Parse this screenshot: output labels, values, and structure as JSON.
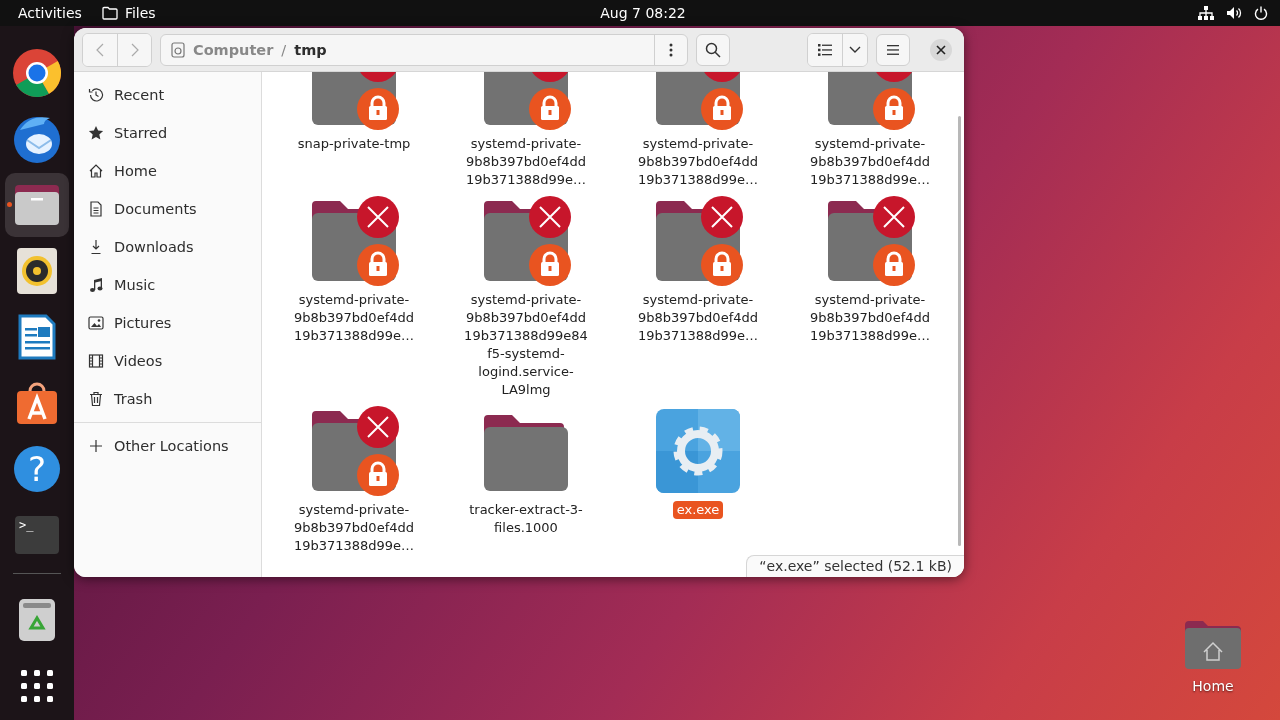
{
  "top_bar": {
    "activities": "Activities",
    "app_name": "Files",
    "clock": "Aug 7  08:22"
  },
  "dock": [
    {
      "kind": "browser",
      "running": false,
      "focused": false
    },
    {
      "kind": "mail",
      "running": false,
      "focused": false
    },
    {
      "kind": "files",
      "running": true,
      "focused": true
    },
    {
      "kind": "music",
      "running": false,
      "focused": false
    },
    {
      "kind": "writer",
      "running": false,
      "focused": false
    },
    {
      "kind": "store",
      "running": false,
      "focused": false
    },
    {
      "kind": "help",
      "glyph": "?",
      "running": false,
      "focused": false
    },
    {
      "kind": "terminal",
      "glyph": ">_",
      "running": false,
      "focused": false
    },
    {
      "kind": "trash",
      "running": false,
      "focused": false
    },
    {
      "kind": "apps",
      "running": false,
      "focused": false
    }
  ],
  "window": {
    "back": {
      "disabled": true
    },
    "forward": {
      "disabled": true
    },
    "path": {
      "segments": [
        {
          "label": "Computer",
          "current": false
        },
        {
          "label": "tmp",
          "current": true
        }
      ],
      "separator": "/"
    },
    "sidebar": {
      "items": [
        {
          "kind": "recent",
          "label": "Recent",
          "selected": false
        },
        {
          "kind": "starred",
          "label": "Starred",
          "selected": false
        },
        {
          "kind": "home",
          "label": "Home",
          "selected": false
        },
        {
          "kind": "documents",
          "label": "Documents",
          "selected": false
        },
        {
          "kind": "downloads",
          "label": "Downloads",
          "selected": false
        },
        {
          "kind": "music",
          "label": "Music",
          "selected": false
        },
        {
          "kind": "pictures",
          "label": "Pictures",
          "selected": false
        },
        {
          "kind": "videos",
          "label": "Videos",
          "selected": false
        },
        {
          "kind": "trash",
          "label": "Trash",
          "selected": false
        }
      ],
      "other": {
        "label": "Other Locations",
        "selected": false
      }
    },
    "files": [
      {
        "kind": "locked-folder",
        "name": "snap-private-tmp",
        "selected": false
      },
      {
        "kind": "locked-folder",
        "name": "systemd-private-9b8b397bd0ef4dd19b371388d99e…",
        "selected": false
      },
      {
        "kind": "locked-folder",
        "name": "systemd-private-9b8b397bd0ef4dd19b371388d99e…",
        "selected": false
      },
      {
        "kind": "locked-folder",
        "name": "systemd-private-9b8b397bd0ef4dd19b371388d99e…",
        "selected": false
      },
      {
        "kind": "locked-folder",
        "name": "systemd-private-9b8b397bd0ef4dd19b371388d99e…",
        "selected": false
      },
      {
        "kind": "locked-folder",
        "name": "systemd-private-9b8b397bd0ef4dd19b371388d99e84f5-systemd-logind.service-LA9lmg",
        "selected": false
      },
      {
        "kind": "locked-folder",
        "name": "systemd-private-9b8b397bd0ef4dd19b371388d99e…",
        "selected": false
      },
      {
        "kind": "locked-folder",
        "name": "systemd-private-9b8b397bd0ef4dd19b371388d99e…",
        "selected": false
      },
      {
        "kind": "locked-folder",
        "name": "systemd-private-9b8b397bd0ef4dd19b371388d99e…",
        "selected": false
      },
      {
        "kind": "folder",
        "name": "tracker-extract-3-files.1000",
        "selected": false
      },
      {
        "kind": "executable",
        "name": "ex.exe",
        "selected": true
      }
    ],
    "status": "“ex.exe” selected (52.1 kB)"
  },
  "desktop_icons": [
    {
      "kind": "home-folder",
      "label": "Home"
    }
  ]
}
